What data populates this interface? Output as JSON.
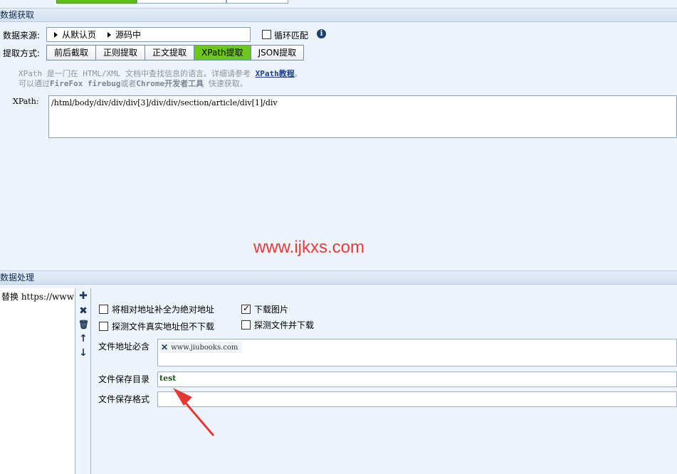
{
  "section1": {
    "title": "数据获取"
  },
  "source": {
    "label": "数据来源:",
    "crumbs": [
      "从默认页",
      "源码中"
    ],
    "loop_label": "循环匹配"
  },
  "method": {
    "label": "提取方式:",
    "tabs": [
      "前后截取",
      "正则提取",
      "正文提取",
      "XPath提取",
      "JSON提取"
    ],
    "active": "XPath提取"
  },
  "hint": {
    "line1_a": "XPath 是一门在 HTML/XML 文档中查找信息的语言。详细请参考 ",
    "line1_link": "XPath教程",
    "line1_b": "。",
    "line2_a": "可以通过",
    "line2_b1": "FireFox firebug",
    "line2_mid": "或者",
    "line2_b2": "Chrome开发者工具",
    "line2_c": " 快速获取。"
  },
  "xpath": {
    "label": "XPath:",
    "value": "/html/body/div/div/div[3]/div/div/section/article/div[1]/div"
  },
  "watermark": "www.ijkxs.com",
  "section2": {
    "title": "数据处理"
  },
  "process_list": [
    "替换 https://www"
  ],
  "options": {
    "relative_to_absolute": "将相对地址补全为绝对地址",
    "download_images": "下载图片",
    "probe_real_url": "探测文件真实地址但不下载",
    "probe_and_download": "探测文件并下载"
  },
  "fields": {
    "url_must_contain_label": "文件地址必含",
    "url_must_contain_tag": "www.jiubooks.com",
    "save_dir_label": "文件保存目录",
    "save_dir_value": "test",
    "save_format_label": "文件保存格式"
  },
  "colors": {
    "active_tab": "#6cc61c",
    "watermark": "#ee3939",
    "arrow": "#e53935"
  }
}
